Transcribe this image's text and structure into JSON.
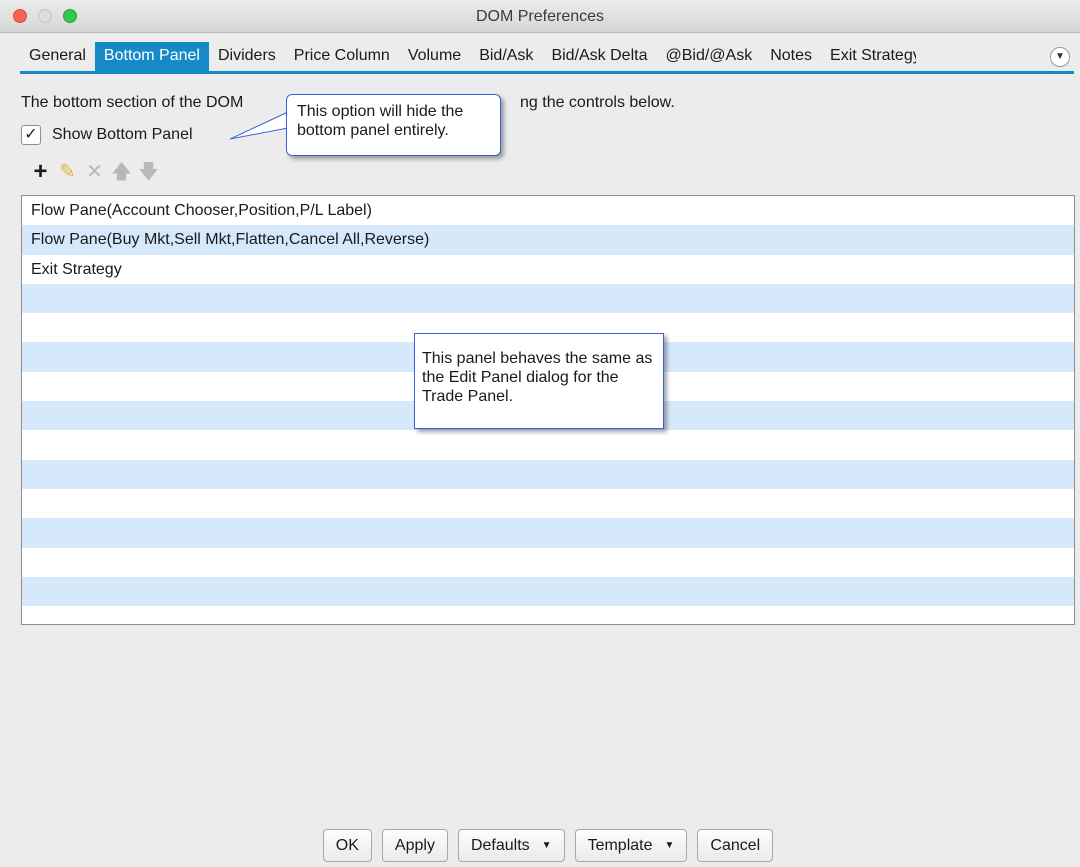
{
  "window": {
    "title": "DOM Preferences"
  },
  "tabs": [
    {
      "label": "General"
    },
    {
      "label": "Bottom Panel",
      "active": true
    },
    {
      "label": "Dividers"
    },
    {
      "label": "Price Column"
    },
    {
      "label": "Volume"
    },
    {
      "label": "Bid/Ask"
    },
    {
      "label": "Bid/Ask Delta"
    },
    {
      "label": "@Bid/@Ask"
    },
    {
      "label": "Notes"
    },
    {
      "label": "Exit Strategy"
    }
  ],
  "tab_overflow_icon": "chevron-down-circle-icon",
  "description": {
    "part1": "The bottom section of the DOM",
    "part2": "ng the controls below."
  },
  "show_bottom_panel": {
    "label": "Show Bottom Panel",
    "checked": true,
    "check_glyph": "✓"
  },
  "toolbar": {
    "add": "+",
    "edit": "✎",
    "remove": "✕",
    "move_up": "🡅",
    "move_down": "🡇"
  },
  "list": {
    "items": [
      "Flow Pane(Account Chooser,Position,P/L Label)",
      "Flow Pane(Buy Mkt,Sell Mkt,Flatten,Cancel All,Reverse)",
      "Exit Strategy"
    ]
  },
  "callouts": {
    "show_panel": "This option will hide the bottom panel entirely.",
    "panel_behavior": "This panel behaves the same as the Edit Panel dialog for the Trade Panel."
  },
  "buttons": {
    "ok": "OK",
    "apply": "Apply",
    "defaults": "Defaults",
    "template": "Template",
    "cancel": "Cancel",
    "dropdown_glyph": "▼"
  },
  "colors": {
    "accent": "#1689c9",
    "row_alt": "#d6e9fb",
    "callout_border": "#3d5fd6",
    "edit_icon": "#e2b23a"
  }
}
